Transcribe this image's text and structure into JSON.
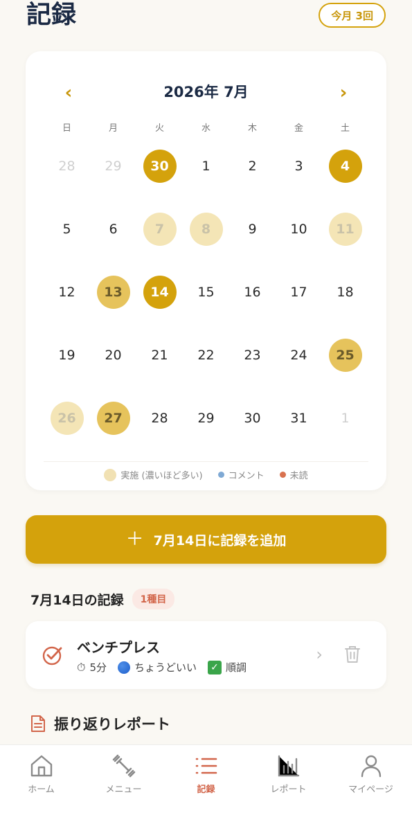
{
  "header": {
    "title": "記録",
    "month_badge": "今月 3回"
  },
  "calendar": {
    "month_label": "2026年 7月",
    "prev_icon": "chevron-left-icon",
    "next_icon": "chevron-right-icon",
    "weekdays": [
      "日",
      "月",
      "火",
      "水",
      "木",
      "金",
      "土"
    ],
    "days": [
      {
        "label": "28",
        "other": true,
        "level": 0
      },
      {
        "label": "29",
        "other": true,
        "level": 0
      },
      {
        "label": "30",
        "other": false,
        "level": 3
      },
      {
        "label": "1",
        "other": false,
        "level": 0
      },
      {
        "label": "2",
        "other": false,
        "level": 0
      },
      {
        "label": "3",
        "other": false,
        "level": 0
      },
      {
        "label": "4",
        "other": false,
        "level": 3
      },
      {
        "label": "5",
        "other": false,
        "level": 0
      },
      {
        "label": "6",
        "other": false,
        "level": 0
      },
      {
        "label": "7",
        "other": false,
        "level": 1
      },
      {
        "label": "8",
        "other": false,
        "level": 1
      },
      {
        "label": "9",
        "other": false,
        "level": 0
      },
      {
        "label": "10",
        "other": false,
        "level": 0
      },
      {
        "label": "11",
        "other": false,
        "level": 1
      },
      {
        "label": "12",
        "other": false,
        "level": 0
      },
      {
        "label": "13",
        "other": false,
        "level": 2
      },
      {
        "label": "14",
        "other": false,
        "level": 3
      },
      {
        "label": "15",
        "other": false,
        "level": 0
      },
      {
        "label": "16",
        "other": false,
        "level": 0
      },
      {
        "label": "17",
        "other": false,
        "level": 0
      },
      {
        "label": "18",
        "other": false,
        "level": 0
      },
      {
        "label": "19",
        "other": false,
        "level": 0
      },
      {
        "label": "20",
        "other": false,
        "level": 0
      },
      {
        "label": "21",
        "other": false,
        "level": 0
      },
      {
        "label": "22",
        "other": false,
        "level": 0
      },
      {
        "label": "23",
        "other": false,
        "level": 0
      },
      {
        "label": "24",
        "other": false,
        "level": 0
      },
      {
        "label": "25",
        "other": false,
        "level": 2
      },
      {
        "label": "26",
        "other": false,
        "level": 1
      },
      {
        "label": "27",
        "other": false,
        "level": 2
      },
      {
        "label": "28",
        "other": false,
        "level": 0
      },
      {
        "label": "29",
        "other": false,
        "level": 0
      },
      {
        "label": "30",
        "other": false,
        "level": 0
      },
      {
        "label": "31",
        "other": false,
        "level": 0
      },
      {
        "label": "1",
        "other": true,
        "level": 0
      }
    ],
    "legend": {
      "done": "実施 (濃いほど多い)",
      "comment": "コメント",
      "unread": "未読"
    }
  },
  "add_button": {
    "icon": "plus-icon",
    "label": "7月14日に記録を追加"
  },
  "records": {
    "title": "7月14日の記録",
    "count": "1種目",
    "items": [
      {
        "name": "ベンチプレス",
        "duration": "5分",
        "intensity": "ちょうどいい",
        "condition": "順調"
      }
    ]
  },
  "report": {
    "title": "振り返りレポート"
  },
  "nav": {
    "items": [
      {
        "label": "ホーム",
        "icon": "home-icon",
        "active": false
      },
      {
        "label": "メニュー",
        "icon": "dumbbell-icon",
        "active": false
      },
      {
        "label": "記録",
        "icon": "list-icon",
        "active": true
      },
      {
        "label": "レポート",
        "icon": "bar-chart-icon",
        "active": false
      },
      {
        "label": "マイページ",
        "icon": "user-icon",
        "active": false
      }
    ]
  },
  "colors": {
    "accent": "#d4a20c",
    "accent_secondary": "#d2654a",
    "title": "#1b2a44"
  }
}
